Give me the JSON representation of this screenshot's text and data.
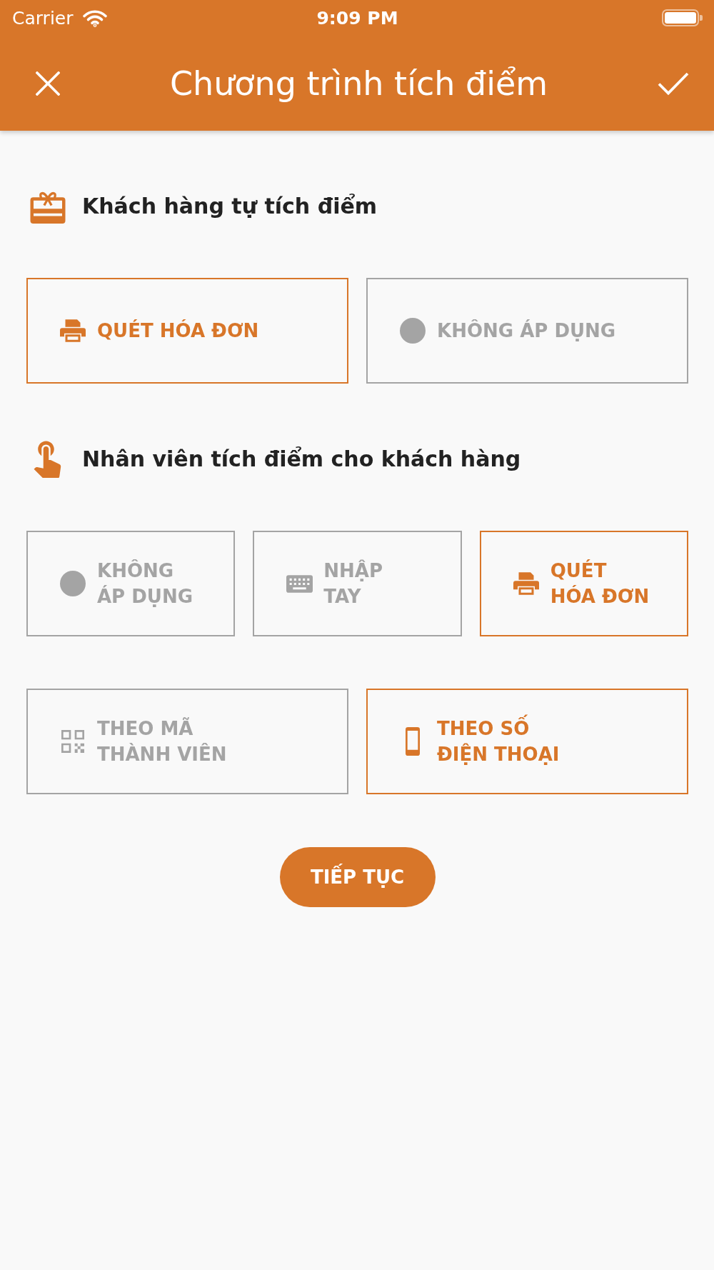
{
  "status_bar": {
    "carrier": "Carrier",
    "time": "9:09 PM"
  },
  "header": {
    "title": "Chương trình tích điểm"
  },
  "sections": [
    {
      "kind": "gift",
      "title": "Khách hàng tự tích điểm",
      "option_rows": [
        [
          {
            "kind": "printer",
            "label": "QUÉT HÓA ĐƠN",
            "selected": true
          },
          {
            "kind": "dot",
            "label": "KHÔNG ÁP DỤNG",
            "selected": false
          }
        ]
      ]
    },
    {
      "kind": "touch",
      "title": "Nhân viên tích điểm cho khách hàng",
      "option_rows": [
        [
          {
            "kind": "dot",
            "label": "KHÔNG\nÁP DỤNG",
            "selected": false
          },
          {
            "kind": "keyboard",
            "label": "NHẬP\nTAY",
            "selected": false
          },
          {
            "kind": "printer",
            "label": "QUÉT\nHÓA ĐƠN",
            "selected": true
          }
        ],
        [
          {
            "kind": "qr",
            "label": "THEO MÃ\nTHÀNH VIÊN",
            "selected": false
          },
          {
            "kind": "phone",
            "label": "THEO SỐ\nĐIỆN THOẠI",
            "selected": true
          }
        ]
      ]
    }
  ],
  "continue_button": {
    "label": "TIẾP TỤC"
  }
}
